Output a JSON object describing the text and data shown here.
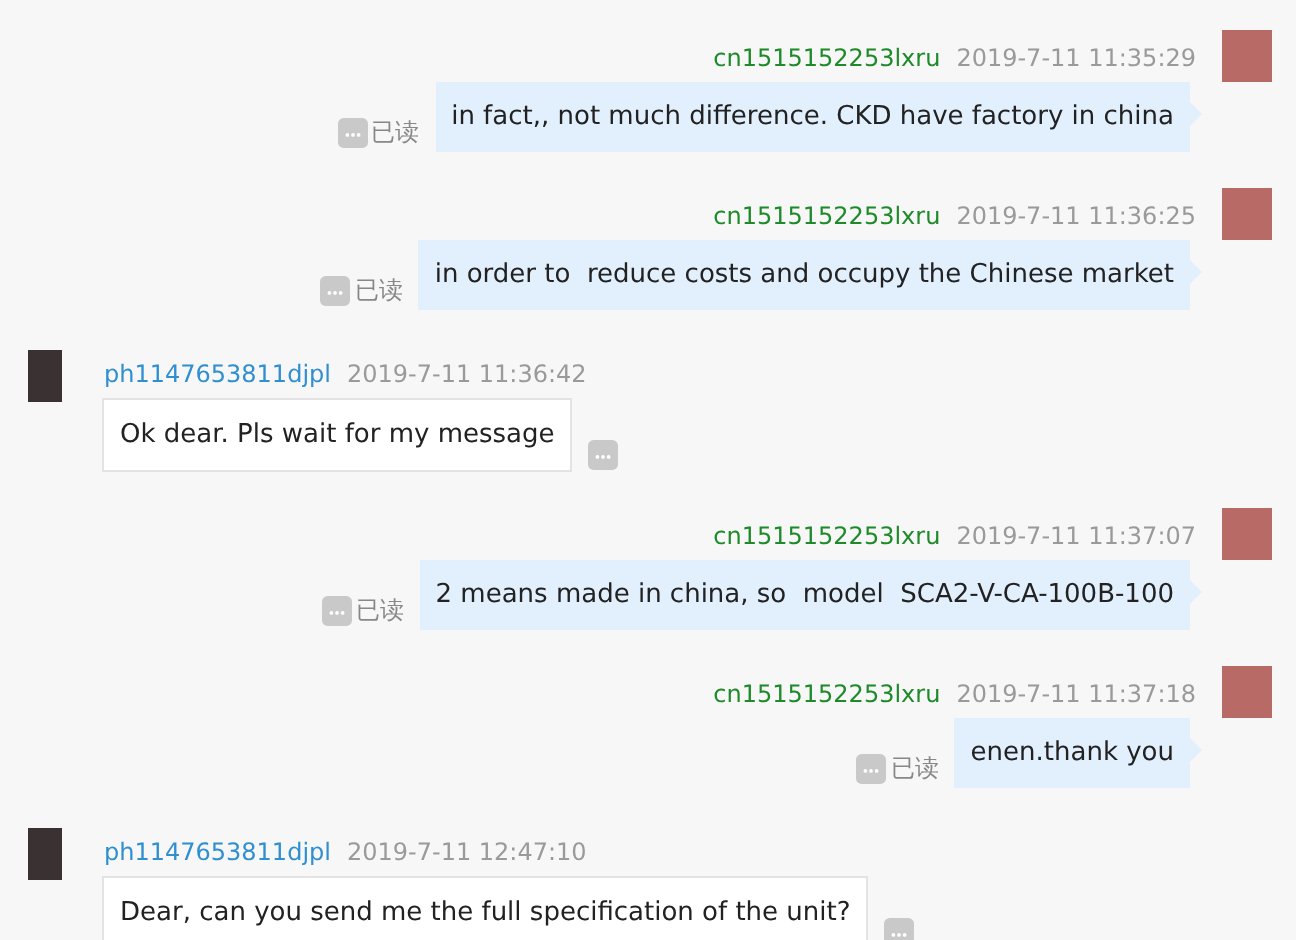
{
  "messages": [
    {
      "kind": "outgoing",
      "sender": "cn1515152253lxru",
      "time": "2019-7-11 11:35:29",
      "text": "in fact,, not much difference. CKD have factory in china",
      "read_label": "已读"
    },
    {
      "kind": "outgoing",
      "sender": "cn1515152253lxru",
      "time": "2019-7-11 11:36:25",
      "text": "in order to  reduce costs and occupy the Chinese market",
      "read_label": "已读"
    },
    {
      "kind": "incoming",
      "sender": "ph1147653811djpl",
      "time": "2019-7-11 11:36:42",
      "text": "Ok dear. Pls wait for my message"
    },
    {
      "kind": "outgoing",
      "sender": "cn1515152253lxru",
      "time": "2019-7-11 11:37:07",
      "text": "2 means made in china, so  model  SCA2-V-CA-100B-100",
      "read_label": "已读"
    },
    {
      "kind": "outgoing",
      "sender": "cn1515152253lxru",
      "time": "2019-7-11 11:37:18",
      "text": "enen.thank you",
      "read_label": "已读"
    },
    {
      "kind": "incoming",
      "sender": "ph1147653811djpl",
      "time": "2019-7-11 12:47:10",
      "text": "Dear, can you send me the full specification of the unit?"
    }
  ]
}
